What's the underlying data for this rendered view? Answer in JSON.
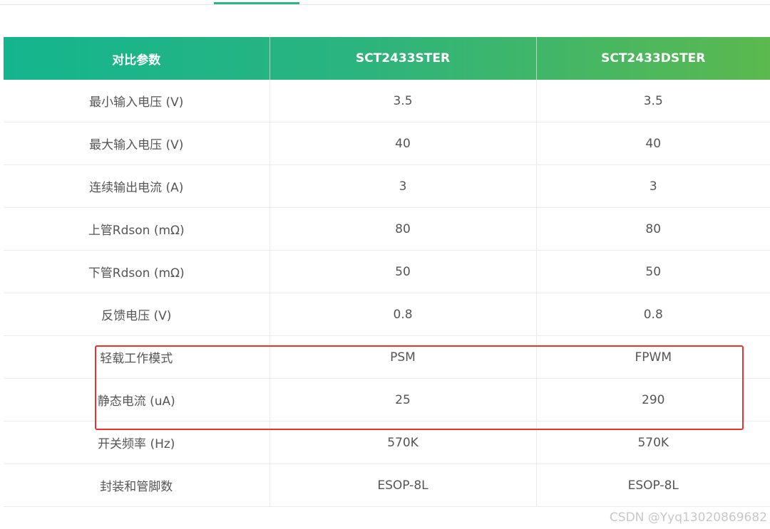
{
  "table": {
    "headers": [
      "对比参数",
      "SCT2433STER",
      "SCT2433DSTER"
    ],
    "rows": [
      [
        "最小输入电压 (V)",
        "3.5",
        "3.5"
      ],
      [
        "最大输入电压 (V)",
        "40",
        "40"
      ],
      [
        "连续输出电流 (A)",
        "3",
        "3"
      ],
      [
        "上管Rdson (mΩ)",
        "80",
        "80"
      ],
      [
        "下管Rdson (mΩ)",
        "50",
        "50"
      ],
      [
        "反馈电压 (V)",
        "0.8",
        "0.8"
      ],
      [
        "轻载工作模式",
        "PSM",
        "FPWM"
      ],
      [
        "静态电流 (uA)",
        "25",
        "290"
      ],
      [
        "开关频率 (Hz)",
        "570K",
        "570K"
      ],
      [
        "封装和管脚数",
        "ESOP-8L",
        "ESOP-8L"
      ]
    ]
  },
  "colors": {
    "header_gradient_start": "#14b58e",
    "header_gradient_end": "#5bb94e",
    "highlight_border": "#e8322d",
    "tab_indicator": "#2db683"
  },
  "watermark": "CSDN @Yyq13020869682"
}
